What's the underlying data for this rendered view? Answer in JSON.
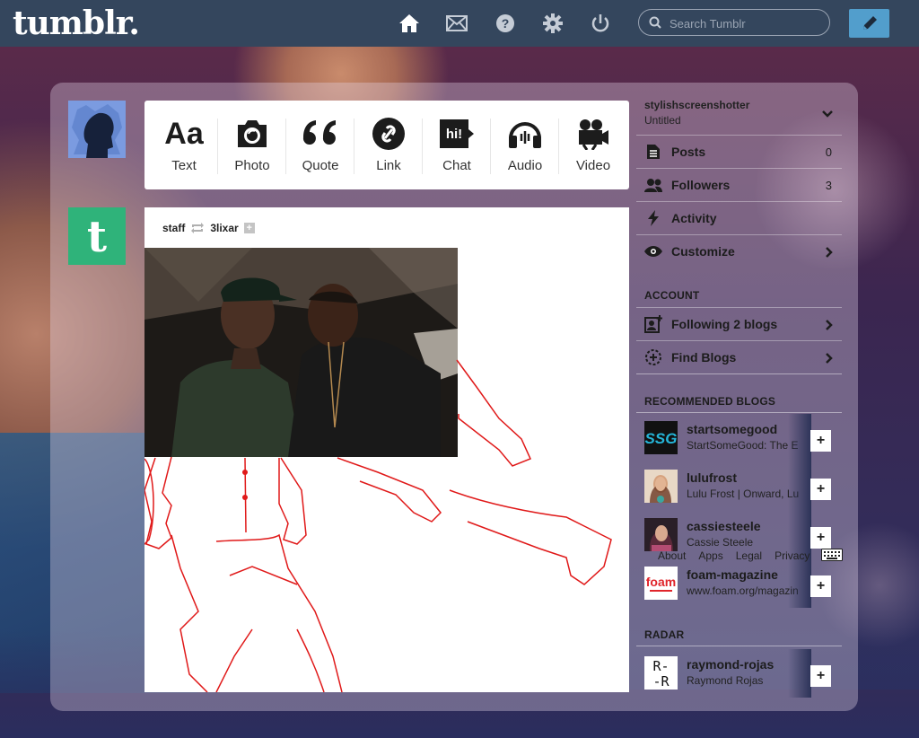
{
  "topbar": {
    "logo": "tumblr.",
    "search_placeholder": "Search Tumblr",
    "icons": [
      "home-icon",
      "mail-icon",
      "help-icon",
      "gear-icon",
      "power-icon"
    ],
    "bg_color": "#34465d",
    "accent": "#529ecc"
  },
  "post_types": [
    {
      "label": "Text",
      "icon": "text-icon",
      "glyph": "Aa"
    },
    {
      "label": "Photo",
      "icon": "camera-icon"
    },
    {
      "label": "Quote",
      "icon": "quote-icon",
      "glyph": "66"
    },
    {
      "label": "Link",
      "icon": "link-icon"
    },
    {
      "label": "Chat",
      "icon": "chat-icon",
      "glyph": "hi!"
    },
    {
      "label": "Audio",
      "icon": "headphones-icon"
    },
    {
      "label": "Video",
      "icon": "video-camera-icon"
    }
  ],
  "post": {
    "author": "staff",
    "reblogged_from": "3lixar"
  },
  "account": {
    "username": "stylishscreenshotter",
    "title": "Untitled"
  },
  "sidebar": {
    "items": [
      {
        "label": "Posts",
        "count": "0",
        "icon": "posts-icon"
      },
      {
        "label": "Followers",
        "count": "3",
        "icon": "followers-icon"
      },
      {
        "label": "Activity",
        "icon": "lightning-icon"
      },
      {
        "label": "Customize",
        "icon": "eye-icon"
      }
    ],
    "account_header": "ACCOUNT",
    "account_items": [
      {
        "label": "Following 2 blogs",
        "icon": "following-icon"
      },
      {
        "label": "Find Blogs",
        "icon": "find-blogs-icon"
      }
    ],
    "recommended_header": "RECOMMENDED BLOGS",
    "recommended": [
      {
        "name": "startsomegood",
        "desc": "StartSomeGood: The E"
      },
      {
        "name": "lulufrost",
        "desc": "Lulu Frost | Onward, Lu"
      },
      {
        "name": "cassiesteele",
        "desc": "Cassie Steele"
      },
      {
        "name": "foam-magazine",
        "desc": "www.foam.org/magazin"
      }
    ],
    "radar_header": "RADAR",
    "radar": [
      {
        "name": "raymond-rojas",
        "desc": "Raymond Rojas"
      }
    ],
    "follow_label": "+"
  },
  "footer": {
    "links": [
      "About",
      "Apps",
      "Legal",
      "Privacy"
    ]
  }
}
